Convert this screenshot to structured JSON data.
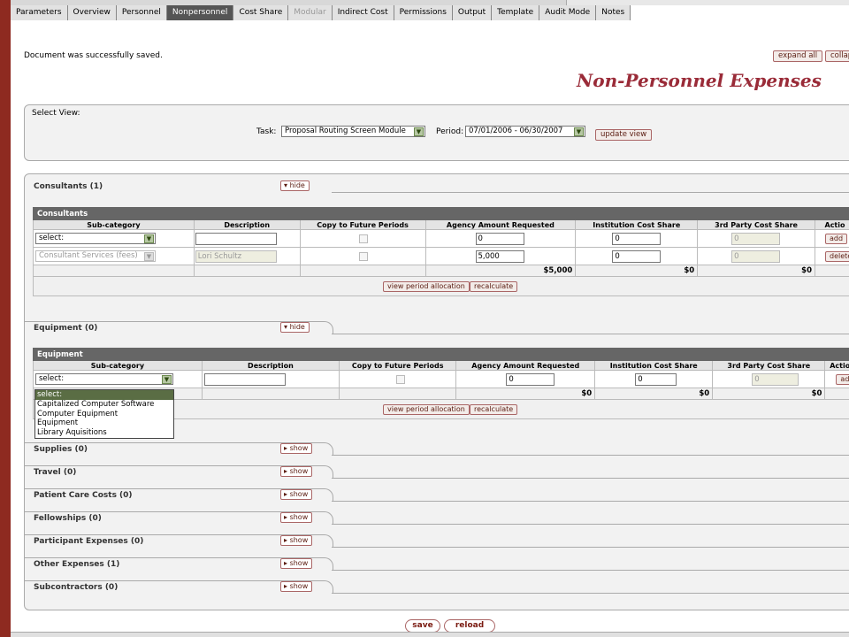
{
  "tabs": [
    {
      "label": "Parameters",
      "state": "normal"
    },
    {
      "label": "Overview",
      "state": "normal"
    },
    {
      "label": "Personnel",
      "state": "normal"
    },
    {
      "label": "Nonpersonnel",
      "state": "active"
    },
    {
      "label": "Cost Share",
      "state": "normal"
    },
    {
      "label": "Modular",
      "state": "disabled"
    },
    {
      "label": "Indirect Cost",
      "state": "normal"
    },
    {
      "label": "Permissions",
      "state": "normal"
    },
    {
      "label": "Output",
      "state": "normal"
    },
    {
      "label": "Template",
      "state": "normal"
    },
    {
      "label": "Audit Mode",
      "state": "normal"
    },
    {
      "label": "Notes",
      "state": "normal"
    }
  ],
  "status_message": "Document was successfully saved.",
  "expand_all_label": "expand all",
  "collapse_all_label": "collap",
  "page_title": "Non-Personnel Expenses",
  "select_view": {
    "title": "Select View:",
    "task_label": "Task:",
    "task_value": "Proposal Routing Screen Module",
    "period_label": "Period:",
    "period_value": "07/01/2006 - 06/30/2007",
    "update_label": "update view"
  },
  "columns": {
    "subcategory": "Sub-category",
    "description": "Description",
    "copy": "Copy to Future Periods",
    "agency": "Agency Amount Requested",
    "institution": "Institution Cost Share",
    "third_party": "3rd Party Cost Share",
    "actions": "Actio"
  },
  "consultants": {
    "header": "Consultants (1)",
    "toggle": "hide",
    "table_title": "Consultants",
    "new_row": {
      "subcategory": "select:",
      "description": "",
      "agency": "0",
      "institution": "0",
      "third_party": "0",
      "action": "add"
    },
    "row": {
      "subcategory": "Consultant Services (fees)",
      "description": "Lori Schultz",
      "agency": "5,000",
      "institution": "0",
      "third_party": "0",
      "action": "delete"
    },
    "totals": {
      "agency": "$5,000",
      "institution": "$0",
      "third_party": "$0"
    },
    "view_alloc": "view period allocation",
    "recalc": "recalculate"
  },
  "equipment": {
    "header": "Equipment (0)",
    "toggle": "hide",
    "table_title": "Equipment",
    "new_row": {
      "subcategory": "select:",
      "description": "",
      "agency": "0",
      "institution": "0",
      "third_party": "0",
      "action": "add"
    },
    "totals": {
      "agency": "$0",
      "institution": "$0",
      "third_party": "$0"
    },
    "view_alloc": "view period allocation",
    "recalc": "recalculate",
    "dropdown_options": [
      "select:",
      "Capitalized Computer Software",
      "Computer Equipment",
      "Equipment",
      "Library Aquisitions"
    ]
  },
  "collapsed_sections": [
    {
      "header": "Supplies (0)",
      "toggle": "show"
    },
    {
      "header": "Travel (0)",
      "toggle": "show"
    },
    {
      "header": "Patient Care Costs (0)",
      "toggle": "show"
    },
    {
      "header": "Fellowships (0)",
      "toggle": "show"
    },
    {
      "header": "Participant Expenses (0)",
      "toggle": "show"
    },
    {
      "header": "Other Expenses (1)",
      "toggle": "show"
    },
    {
      "header": "Subcontractors (0)",
      "toggle": "show"
    }
  ],
  "save_label": "save",
  "reload_label": "reload",
  "colors": {
    "accent": "#8e2a20",
    "title": "#9a2b38",
    "active_tab": "#555555"
  }
}
